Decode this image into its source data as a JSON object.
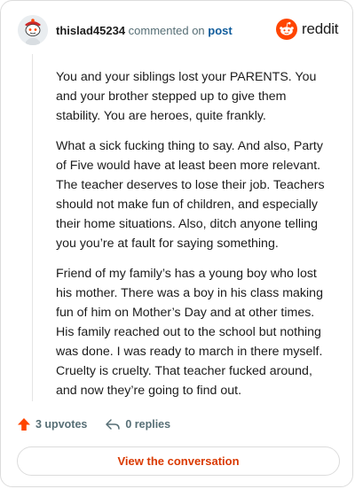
{
  "header": {
    "username": "thislad45234",
    "action_text": "commented on",
    "post_link": "post",
    "avatar_icon": "snoo-avatar-icon",
    "logo_icon": "reddit-alien-icon",
    "logo_text": "reddit"
  },
  "comment": {
    "paragraphs": [
      "You and your siblings lost your PARENTS. You and your brother stepped up to give them stability. You are heroes, quite frankly.",
      "What a sick fucking thing to say. And also, Party of Five would have at least been more relevant. The teacher deserves to lose their job. Teachers should not make fun of children, and especially their home situations. Also, ditch anyone telling you you’re at fault for saying something.",
      "Friend of my family’s has a young boy who lost his mother. There was a boy in his class making fun of him on Mother’s Day and at other times. His family reached out to the school but nothing was done. I was ready to march in there myself. Cruelty is cruelty. That teacher fucked around, and now they’re going to find out."
    ]
  },
  "actions": {
    "upvotes": "3 upvotes",
    "upvote_icon": "upvote-arrow-icon",
    "replies": "0 replies",
    "reply_icon": "reply-arrow-icon"
  },
  "button": {
    "label": "View the conversation"
  },
  "colors": {
    "brand": "#ff4500",
    "link": "#0f5c9c",
    "button_text": "#d93900",
    "muted": "#576f76"
  }
}
